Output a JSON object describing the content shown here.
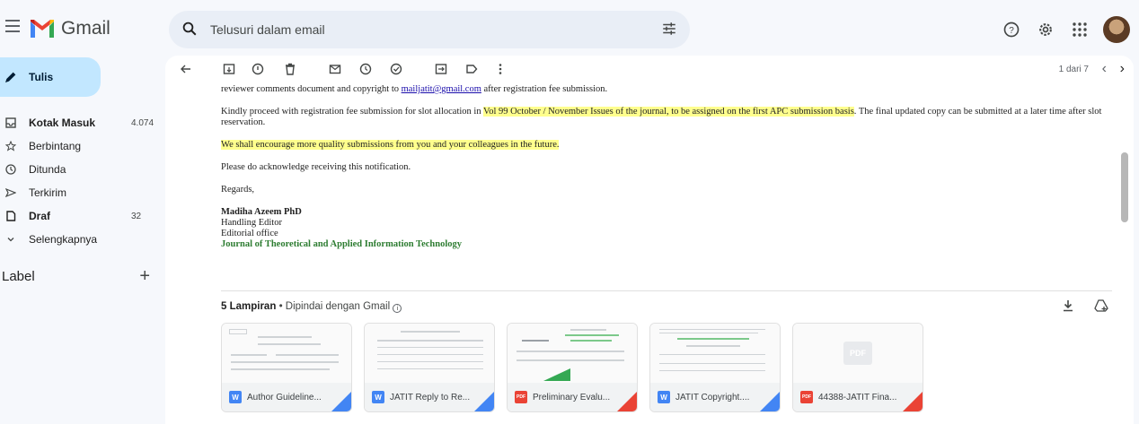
{
  "brand": {
    "name": "Gmail"
  },
  "search": {
    "placeholder": "Telusuri dalam email"
  },
  "compose": {
    "label": "Tulis"
  },
  "nav": [
    {
      "label": "Kotak Masuk",
      "count": "4.074",
      "bold": true,
      "icon": "inbox-icon"
    },
    {
      "label": "Berbintang",
      "count": "",
      "bold": false,
      "icon": "star-icon"
    },
    {
      "label": "Ditunda",
      "count": "",
      "bold": false,
      "icon": "clock-icon"
    },
    {
      "label": "Terkirim",
      "count": "",
      "bold": false,
      "icon": "send-icon"
    },
    {
      "label": "Draf",
      "count": "32",
      "bold": true,
      "icon": "draft-icon"
    },
    {
      "label": "Selengkapnya",
      "count": "",
      "bold": false,
      "icon": "chevron-down-icon"
    }
  ],
  "labels": {
    "title": "Label"
  },
  "pager": {
    "text": "1 dari 7"
  },
  "email": {
    "line0_pre": "reviewer comments document and copyright to ",
    "line0_link": "mailjatit@gmail.com",
    "line0_post": " after registration fee submission.",
    "p1_pre": "Kindly proceed with registration fee submission for slot allocation in ",
    "p1_hl": "Vol 99 October / November Issues of the journal, to be assigned on the first APC submission basis",
    "p1_post": ". The final updated copy can be submitted at a later time after slot reservation.",
    "p2": "We shall encourage more quality submissions from you and your colleagues in the future.",
    "p3": "Please do acknowledge receiving this notification.",
    "p4": "Regards,",
    "sig_name": "Madiha Azeem PhD",
    "sig_role": "Handling Editor",
    "sig_office": "Editorial office",
    "sig_journal": "Journal of Theoretical and Applied Information Technology"
  },
  "attachments": {
    "count_label": "5 Lampiran",
    "scan_label": "• Dipindai dengan Gmail",
    "items": [
      {
        "name": "Author Guideline...",
        "type": "W"
      },
      {
        "name": "JATIT Reply to Re...",
        "type": "W"
      },
      {
        "name": "Preliminary Evalu...",
        "type": "PDF"
      },
      {
        "name": "JATIT Copyright....",
        "type": "W"
      },
      {
        "name": "44388-JATIT Fina...",
        "type": "PDF"
      }
    ],
    "pdf_thumb_label": "PDF"
  },
  "colors": {
    "compose_bg": "#c2e7ff",
    "highlight": "#ffff8d",
    "journal": "#2e7d32",
    "word": "#4285f4",
    "pdf": "#ea4335"
  }
}
